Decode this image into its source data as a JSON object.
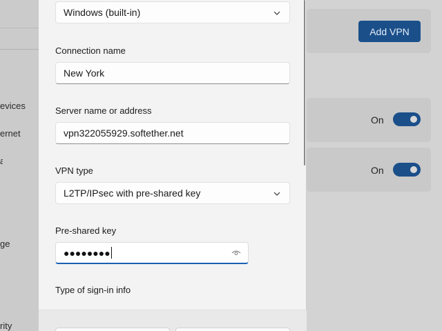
{
  "background": {
    "sidebar_items": [
      "evices",
      "ernet",
      "a",
      "ge",
      "rity"
    ],
    "add_vpn_label": "Add VPN",
    "toggle_rows": [
      {
        "state_label": "On"
      },
      {
        "state_label": "On"
      }
    ]
  },
  "dialog": {
    "provider_value": "Windows (built-in)",
    "connection_name_label": "Connection name",
    "connection_name_value": "New York",
    "server_label": "Server name or address",
    "server_value": "vpn322055929.softether.net",
    "vpn_type_label": "VPN type",
    "vpn_type_value": "L2TP/IPsec with pre-shared key",
    "psk_label": "Pre-shared key",
    "psk_masked": "●●●●●●●●",
    "signin_label": "Type of sign-in info"
  },
  "icons": {
    "chevron": "chevron-down-icon",
    "reveal": "eye-icon"
  },
  "colors": {
    "accent": "#1a5fb4",
    "toggle_on": "#1a4f8a",
    "dialog_bg": "#f3f3f3"
  }
}
